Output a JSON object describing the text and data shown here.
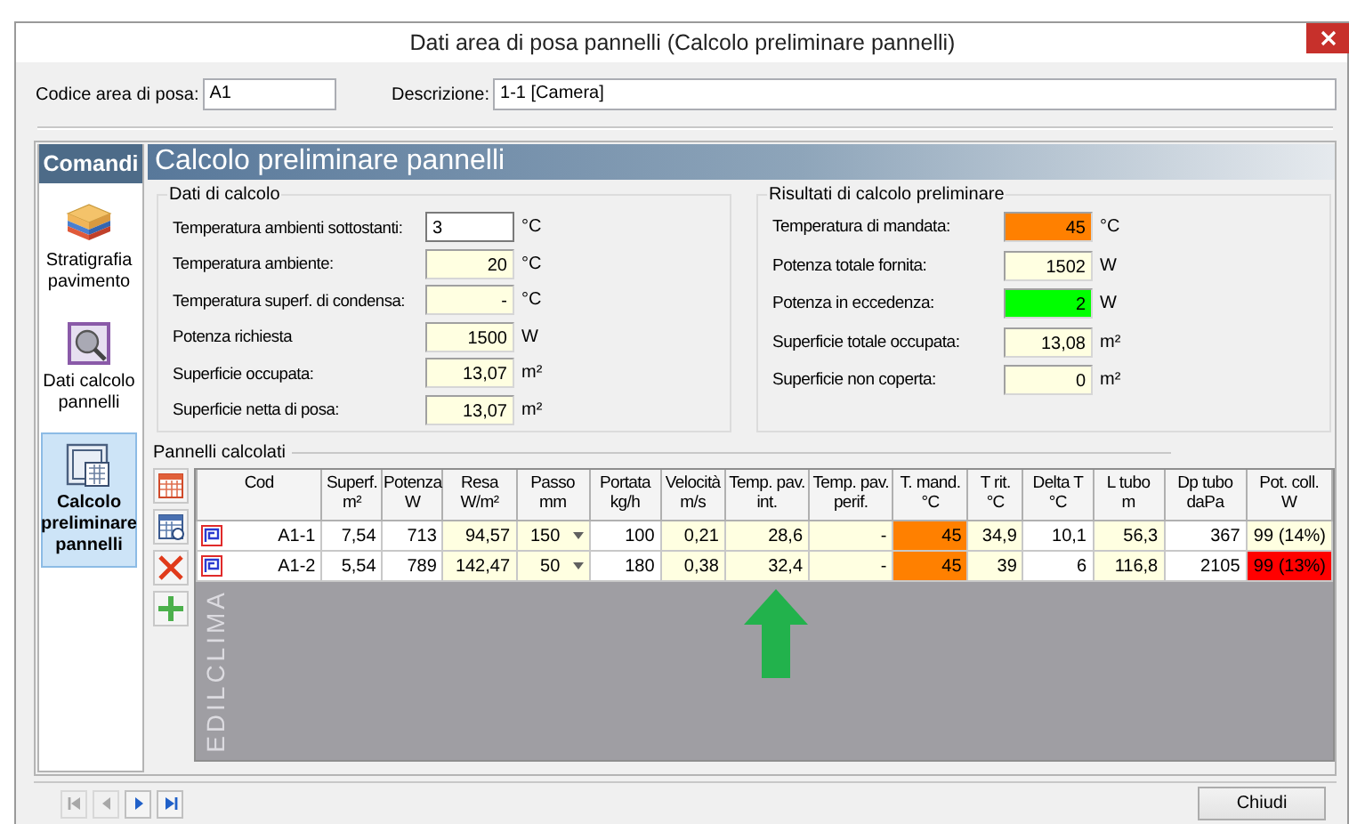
{
  "window": {
    "title": "Dati area di posa pannelli (Calcolo preliminare pannelli)"
  },
  "header_fields": [
    {
      "label": "Codice area di posa:",
      "value": "A1",
      "kind": "short"
    },
    {
      "label": "Descrizione:",
      "value": "1-1 [Camera]",
      "kind": "wide"
    }
  ],
  "sidebar": {
    "title": "Comandi",
    "items": [
      {
        "label": "Stratigrafia pavimento",
        "kind": "layers",
        "selected": false
      },
      {
        "label": "Dati calcolo pannelli",
        "kind": "inspect",
        "selected": false
      },
      {
        "label": "Calcolo preliminare pannelli",
        "kind": "calc",
        "selected": true
      }
    ]
  },
  "section_title": "Calcolo preliminare pannelli",
  "input_group": {
    "title": "Dati di calcolo",
    "rows": [
      {
        "label": "Temperatura ambienti sottostanti:",
        "value": "3",
        "unit": "°C",
        "editable": true,
        "color": "#ffffff"
      },
      {
        "label": "Temperatura ambiente:",
        "value": "20",
        "unit": "°C",
        "editable": false,
        "color": "#ffffe1"
      },
      {
        "label": "Temperatura superf. di condensa:",
        "value": "-",
        "unit": "°C",
        "editable": false,
        "color": "#ffffe1"
      },
      {
        "label": "Potenza richiesta",
        "value": "1500",
        "unit": "W",
        "editable": false,
        "color": "#ffffe1"
      },
      {
        "label": "Superficie occupata:",
        "value": "13,07",
        "unit": "m²",
        "editable": false,
        "color": "#ffffe1"
      },
      {
        "label": "Superficie netta di posa:",
        "value": "13,07",
        "unit": "m²",
        "editable": false,
        "color": "#ffffe1"
      }
    ]
  },
  "result_group": {
    "title": "Risultati di calcolo preliminare",
    "rows": [
      {
        "label": "Temperatura di mandata:",
        "value": "45",
        "unit": "°C",
        "color": "#ff8000"
      },
      {
        "label": "Potenza totale fornita:",
        "value": "1502",
        "unit": "W",
        "color": "#ffffe1"
      },
      {
        "label": "Potenza in eccedenza:",
        "value": "2",
        "unit": "W",
        "color": "#00ff00"
      },
      {
        "label": "Superficie totale occupata:",
        "value": "13,08",
        "unit": "m²",
        "color": "#ffffe1"
      },
      {
        "label": "Superficie non coperta:",
        "value": "0",
        "unit": "m²",
        "color": "#ffffe1"
      }
    ]
  },
  "panels": {
    "title": "Pannelli calcolati",
    "tools": [
      {
        "kind": "table"
      },
      {
        "kind": "recalc"
      },
      {
        "kind": "delete"
      },
      {
        "kind": "add"
      }
    ],
    "columns": [
      {
        "label": "Cod",
        "kind": "code"
      },
      {
        "label": "Superf.\nm²",
        "kind": "text"
      },
      {
        "label": "Potenza\nW",
        "kind": "text"
      },
      {
        "label": "Resa\nW/m²",
        "kind": "text"
      },
      {
        "label": "Passo\nmm",
        "kind": "select"
      },
      {
        "label": "Portata\nkg/h",
        "kind": "text"
      },
      {
        "label": "Velocità\nm/s",
        "kind": "text"
      },
      {
        "label": "Temp. pav.\nint.",
        "kind": "text"
      },
      {
        "label": "Temp. pav.\nperif.",
        "kind": "text"
      },
      {
        "label": "T. mand.\n°C",
        "kind": "text"
      },
      {
        "label": "T rit.\n°C",
        "kind": "text"
      },
      {
        "label": "Delta T\n°C",
        "kind": "text"
      },
      {
        "label": "L tubo\nm",
        "kind": "text"
      },
      {
        "label": "Dp tubo\ndaPa",
        "kind": "text"
      },
      {
        "label": "Pot. coll.\nW",
        "kind": "text"
      }
    ],
    "rows": [
      [
        {
          "text": "A1-1",
          "color": "#ffffff"
        },
        {
          "text": "7,54",
          "color": "#ffffff"
        },
        {
          "text": "713",
          "color": "#ffffff"
        },
        {
          "text": "94,57",
          "color": "#ffffe1"
        },
        {
          "text": "150",
          "color": "#ffffe1"
        },
        {
          "text": "100",
          "color": "#ffffff"
        },
        {
          "text": "0,21",
          "color": "#ffffe1"
        },
        {
          "text": "28,6",
          "color": "#ffffe1"
        },
        {
          "text": "-",
          "color": "#ffffe1"
        },
        {
          "text": "45",
          "color": "#ff8000"
        },
        {
          "text": "34,9",
          "color": "#ffffe1"
        },
        {
          "text": "10,1",
          "color": "#ffffff"
        },
        {
          "text": "56,3",
          "color": "#ffffe1"
        },
        {
          "text": "367",
          "color": "#ffffff"
        },
        {
          "text": "99 (14%)",
          "color": "#ffffe1"
        }
      ],
      [
        {
          "text": "A1-2",
          "color": "#ffffff"
        },
        {
          "text": "5,54",
          "color": "#ffffff"
        },
        {
          "text": "789",
          "color": "#ffffff"
        },
        {
          "text": "142,47",
          "color": "#ffffe1"
        },
        {
          "text": "50",
          "color": "#ffffe1"
        },
        {
          "text": "180",
          "color": "#ffffff"
        },
        {
          "text": "0,38",
          "color": "#ffffe1"
        },
        {
          "text": "32,4",
          "color": "#ffffe1"
        },
        {
          "text": "-",
          "color": "#ffffe1"
        },
        {
          "text": "45",
          "color": "#ff8000"
        },
        {
          "text": "39",
          "color": "#ffffe1"
        },
        {
          "text": "6",
          "color": "#ffffff"
        },
        {
          "text": "116,8",
          "color": "#ffffe1"
        },
        {
          "text": "2105",
          "color": "#ffffff"
        },
        {
          "text": "99 (13%)",
          "color": "#ff0000"
        }
      ]
    ],
    "background_logo": "EDILCLIMA"
  },
  "navigation": [
    {
      "kind": "first",
      "disabled": true
    },
    {
      "kind": "prev",
      "disabled": true
    },
    {
      "kind": "next",
      "disabled": false
    },
    {
      "kind": "last",
      "disabled": false
    }
  ],
  "buttons": [
    "Chiudi"
  ]
}
